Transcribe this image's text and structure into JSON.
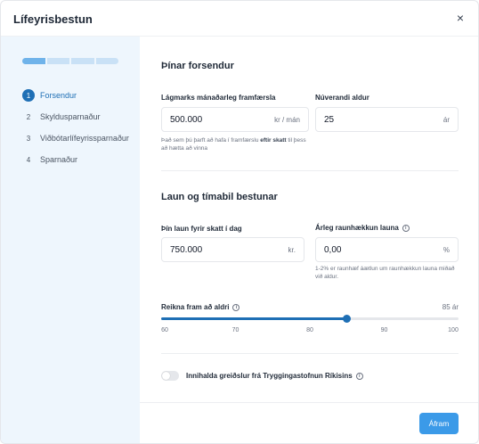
{
  "header": {
    "title": "Lífeyrisbestun",
    "close_symbol": "×"
  },
  "sidebar": {
    "progress": {
      "current_step": 1,
      "total_steps": 4
    },
    "steps": [
      {
        "num": "1",
        "label": "Forsendur"
      },
      {
        "num": "2",
        "label": "Skyldusparnaður"
      },
      {
        "num": "3",
        "label": "Viðbótarlífeyrissparnaður"
      },
      {
        "num": "4",
        "label": "Sparnaður"
      }
    ]
  },
  "assumptions": {
    "title": "Þínar forsendur",
    "min_expenses": {
      "label": "Lágmarks mánaðarleg framfærsla",
      "value": "500.000",
      "unit": "kr / mán",
      "hint_pre": "Það sem þú þarft að hafa í framfærslu ",
      "hint_bold": "eftir skatt",
      "hint_post": " til þess að hætta að vinna"
    },
    "current_age": {
      "label": "Núverandi aldur",
      "value": "25",
      "unit": "ár"
    }
  },
  "salary": {
    "title": "Laun og tímabil bestunar",
    "pretax": {
      "label": "Þín laun fyrir skatt í dag",
      "value": "750.000",
      "unit": "kr."
    },
    "raise": {
      "label": "Árleg raunhækkun launa",
      "value": "0,00",
      "unit": "%",
      "hint": "1-2% er raunhæf áætlun um raunhækkun launa miðað við aldur."
    },
    "project_age": {
      "label": "Reikna fram að aldri",
      "value_display": "85 ár",
      "value": 85,
      "min": 60,
      "max": 100,
      "ticks": [
        "60",
        "70",
        "80",
        "90",
        "100"
      ]
    }
  },
  "toggle": {
    "label": "Innihalda greiðslur frá Tryggingastofnun Ríkisins",
    "on": false
  },
  "footer": {
    "next_label": "Áfram"
  },
  "icons": {
    "info": "info-icon",
    "close": "close-icon"
  },
  "colors": {
    "accent": "#1e6fb5",
    "button": "#3b9ae8",
    "sidebar_bg": "#eef6fd"
  }
}
